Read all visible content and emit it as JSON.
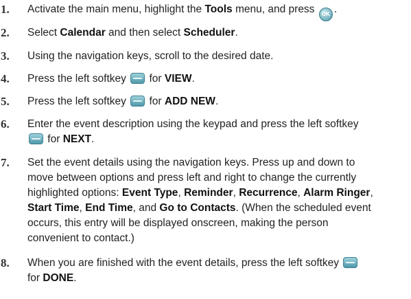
{
  "steps": [
    {
      "number": "1.",
      "lines": [
        {
          "segments": [
            {
              "t": "Activate the main menu, highlight the "
            },
            {
              "t": "Tools",
              "b": true
            },
            {
              "t": " menu, and press "
            },
            {
              "icon": "ok-key-icon",
              "label": "OK"
            },
            {
              "t": "."
            }
          ]
        }
      ]
    },
    {
      "number": "2.",
      "lines": [
        {
          "segments": [
            {
              "t": "Select "
            },
            {
              "t": "Calendar",
              "b": true
            },
            {
              "t": " and then select "
            },
            {
              "t": "Scheduler",
              "b": true
            },
            {
              "t": "."
            }
          ]
        }
      ]
    },
    {
      "number": "3.",
      "lines": [
        {
          "segments": [
            {
              "t": "Using the navigation keys, scroll to the desired date."
            }
          ]
        }
      ]
    },
    {
      "number": "4.",
      "lines": [
        {
          "segments": [
            {
              "t": "Press the left softkey "
            },
            {
              "icon": "softkey-icon"
            },
            {
              "t": " for "
            },
            {
              "t": "VIEW",
              "b": true
            },
            {
              "t": "."
            }
          ]
        }
      ]
    },
    {
      "number": "5.",
      "lines": [
        {
          "segments": [
            {
              "t": "Press the left softkey "
            },
            {
              "icon": "softkey-icon"
            },
            {
              "t": " for "
            },
            {
              "t": "ADD NEW",
              "b": true
            },
            {
              "t": "."
            }
          ]
        }
      ]
    },
    {
      "number": "6.",
      "lines": [
        {
          "segments": [
            {
              "t": "Enter the event description using the keypad and press the left softkey"
            }
          ]
        },
        {
          "segments": [
            {
              "icon": "softkey-icon"
            },
            {
              "t": " for "
            },
            {
              "t": "NEXT",
              "b": true
            },
            {
              "t": "."
            }
          ]
        }
      ]
    },
    {
      "number": "7.",
      "lines": [
        {
          "segments": [
            {
              "t": "Set the event details using the navigation keys. Press up and down to"
            }
          ]
        },
        {
          "segments": [
            {
              "t": "move between options and press left and right to change the currently"
            }
          ]
        },
        {
          "segments": [
            {
              "t": "highlighted options: "
            },
            {
              "t": "Event Type",
              "b": true
            },
            {
              "t": ", "
            },
            {
              "t": "Reminder",
              "b": true
            },
            {
              "t": ", "
            },
            {
              "t": "Recurrence",
              "b": true
            },
            {
              "t": ", "
            },
            {
              "t": "Alarm Ringer",
              "b": true
            },
            {
              "t": ","
            }
          ]
        },
        {
          "segments": [
            {
              "t": "Start Time",
              "b": true
            },
            {
              "t": ", "
            },
            {
              "t": "End Time",
              "b": true
            },
            {
              "t": ", and "
            },
            {
              "t": "Go to Contacts",
              "b": true
            },
            {
              "t": ". (When the scheduled event"
            }
          ]
        },
        {
          "segments": [
            {
              "t": "occurs, this entry will be displayed onscreen, making the person"
            }
          ]
        },
        {
          "segments": [
            {
              "t": "convenient to contact.)"
            }
          ]
        }
      ]
    },
    {
      "number": "8.",
      "lines": [
        {
          "segments": [
            {
              "t": "When you are finished with the event details, press the left softkey "
            },
            {
              "icon": "softkey-icon"
            }
          ]
        },
        {
          "segments": [
            {
              "t": "for "
            },
            {
              "t": "DONE",
              "b": true
            },
            {
              "t": "."
            }
          ]
        }
      ]
    }
  ]
}
